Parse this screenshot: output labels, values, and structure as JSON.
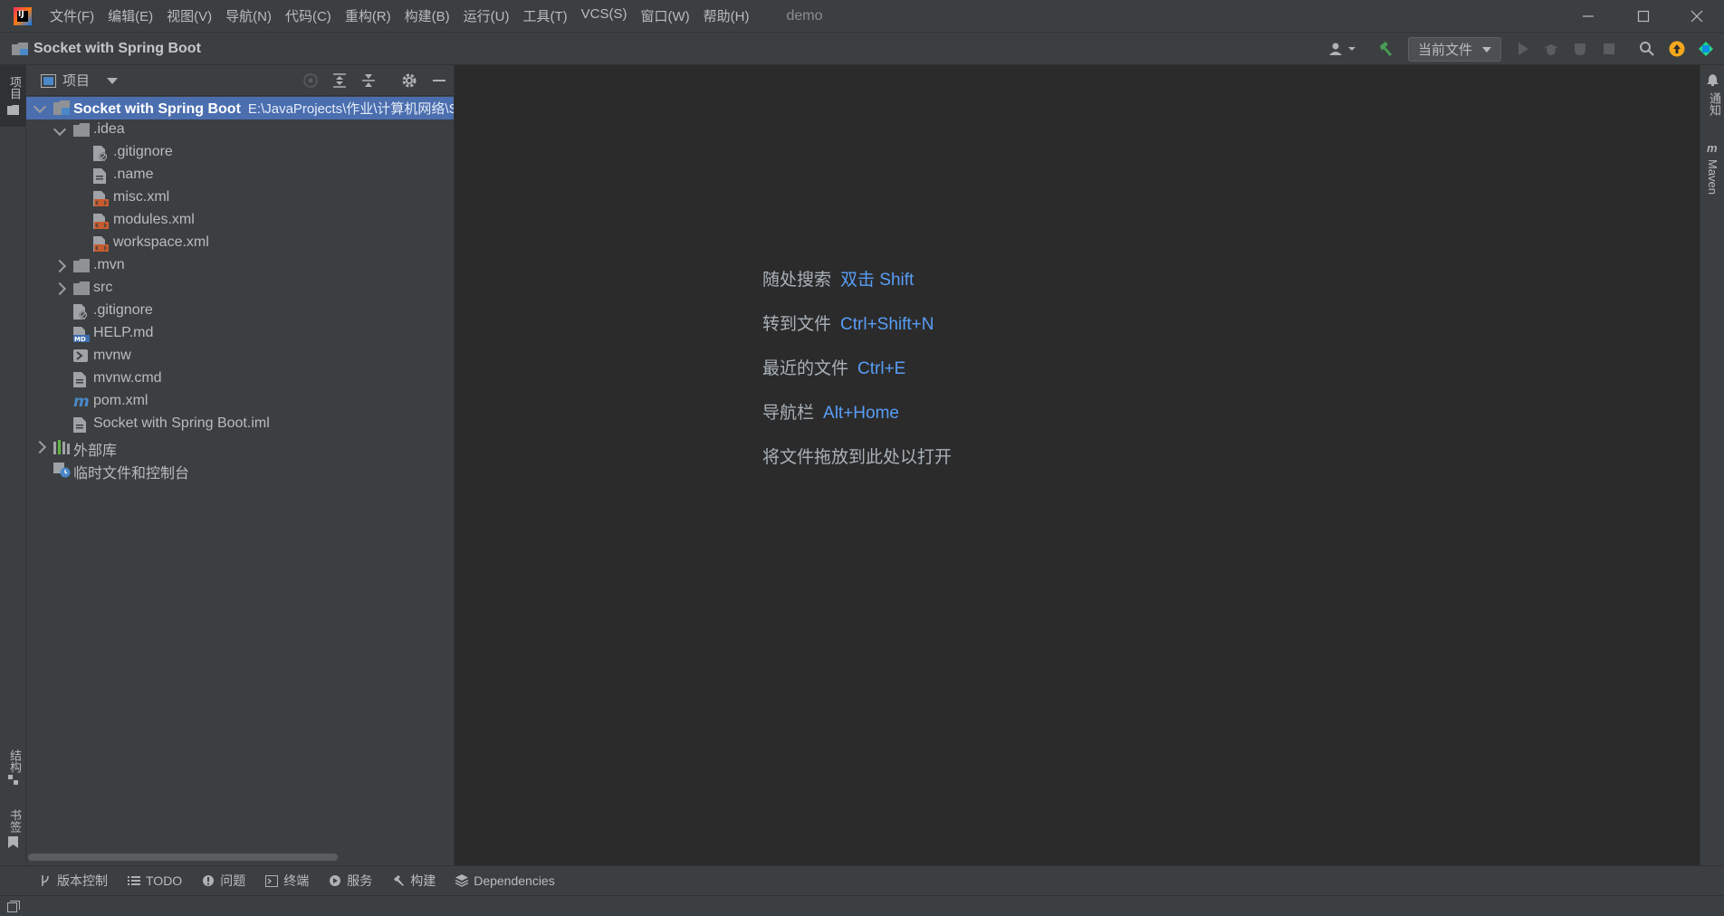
{
  "menu": {
    "items": [
      "文件(F)",
      "编辑(E)",
      "视图(V)",
      "导航(N)",
      "代码(C)",
      "重构(R)",
      "构建(B)",
      "运行(U)",
      "工具(T)",
      "VCS(S)",
      "窗口(W)",
      "帮助(H)"
    ],
    "window_title": "demo"
  },
  "navbar": {
    "project_title": "Socket with Spring Boot",
    "run_config": "当前文件"
  },
  "left_stripe": {
    "project_tab": "项目",
    "structure_tab": "结构",
    "bookmarks_tab": "书签"
  },
  "right_stripe": {
    "notifications_tab": "通知",
    "maven_tab": "Maven"
  },
  "project_panel": {
    "title": "项目",
    "tree": [
      {
        "label": "Socket with Spring Boot",
        "path": "E:\\JavaProjects\\作业\\计算机网络\\S",
        "depth": 0,
        "expanded": true,
        "type": "module",
        "selected": true
      },
      {
        "label": ".idea",
        "depth": 1,
        "expanded": true,
        "type": "folder"
      },
      {
        "label": ".gitignore",
        "depth": 2,
        "type": "gitignore"
      },
      {
        "label": ".name",
        "depth": 2,
        "type": "file"
      },
      {
        "label": "misc.xml",
        "depth": 2,
        "type": "xml"
      },
      {
        "label": "modules.xml",
        "depth": 2,
        "type": "xml"
      },
      {
        "label": "workspace.xml",
        "depth": 2,
        "type": "xml"
      },
      {
        "label": ".mvn",
        "depth": 1,
        "expanded": false,
        "type": "folder"
      },
      {
        "label": "src",
        "depth": 1,
        "expanded": false,
        "type": "folder"
      },
      {
        "label": ".gitignore",
        "depth": 1,
        "type": "gitignore"
      },
      {
        "label": "HELP.md",
        "depth": 1,
        "type": "md"
      },
      {
        "label": "mvnw",
        "depth": 1,
        "type": "exec"
      },
      {
        "label": "mvnw.cmd",
        "depth": 1,
        "type": "file"
      },
      {
        "label": "pom.xml",
        "depth": 1,
        "type": "maven"
      },
      {
        "label": "Socket with Spring Boot.iml",
        "depth": 1,
        "type": "file"
      },
      {
        "label": "外部库",
        "depth": 0,
        "expanded": false,
        "type": "library"
      },
      {
        "label": "临时文件和控制台",
        "depth": 0,
        "type": "scratch"
      }
    ]
  },
  "editor_hints": [
    {
      "text": "随处搜索",
      "key": "双击 Shift"
    },
    {
      "text": "转到文件",
      "key": "Ctrl+Shift+N"
    },
    {
      "text": "最近的文件",
      "key": "Ctrl+E"
    },
    {
      "text": "导航栏",
      "key": "Alt+Home"
    },
    {
      "text": "将文件拖放到此处以打开",
      "key": ""
    }
  ],
  "bottom_tabs": [
    {
      "label": "版本控制",
      "icon": "branch-icon"
    },
    {
      "label": "TODO",
      "icon": "list-icon"
    },
    {
      "label": "问题",
      "icon": "problems-icon"
    },
    {
      "label": "终端",
      "icon": "terminal-icon"
    },
    {
      "label": "服务",
      "icon": "services-icon"
    },
    {
      "label": "构建",
      "icon": "hammer-icon"
    },
    {
      "label": "Dependencies",
      "icon": "dependencies-icon"
    }
  ],
  "colors": {
    "accent": "#4b6eaf",
    "shortcut": "#589df6",
    "build_green": "#499c54",
    "update_orange": "#f4a81d"
  }
}
